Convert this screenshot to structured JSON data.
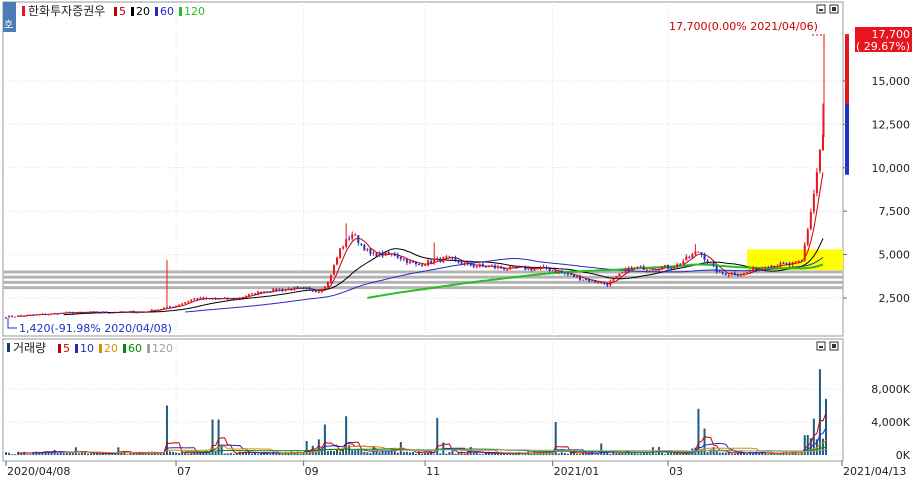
{
  "colors": {
    "up": "#e8141e",
    "down": "#1e32c8",
    "ma5": "#c80000",
    "ma20": "#000000",
    "ma60": "#2828c8",
    "ma120": "#22c022",
    "vol": "#1e5a82",
    "vol_ma5": "#c80000",
    "vol_ma10": "#2828c8",
    "vol_ma20": "#e08c00",
    "vol_ma60": "#008c00",
    "vol_ma120": "#a0a0a0",
    "highlight": "#ffff00",
    "last_price_box": "#e8141e",
    "grid": "#dcdcdc"
  },
  "header": {
    "corner_label": "호",
    "stock_name": "한화투자증권우",
    "ma_legend": [
      {
        "label": "5",
        "color": "#c80000"
      },
      {
        "label": "20",
        "color": "#000000"
      },
      {
        "label": "60",
        "color": "#2828c8"
      },
      {
        "label": "120",
        "color": "#22c022"
      }
    ]
  },
  "volume_header": {
    "title": "거래량",
    "ma_legend": [
      {
        "label": "5",
        "color": "#c80000"
      },
      {
        "label": "10",
        "color": "#2828c8"
      },
      {
        "label": "20",
        "color": "#e08c00"
      },
      {
        "label": "60",
        "color": "#008c00"
      },
      {
        "label": "120",
        "color": "#a0a0a0"
      }
    ]
  },
  "annotations": {
    "high": "17,700(0.00% 2021/04/06)",
    "low": "1,420(-91.98% 2020/04/08)",
    "last_price": "17,700",
    "last_change": "( 29.67%)"
  },
  "chart_data": [
    {
      "type": "candlestick",
      "y_axis_ticks": [
        "15,000",
        "12,500",
        "10,000",
        "7,500",
        "5,000",
        "2,500"
      ],
      "ylim": [
        1000,
        19000
      ],
      "x_ticks": [
        "2020/04/08",
        "07",
        "09",
        "11",
        "2021/01",
        "03",
        "2021/04/13"
      ],
      "anchors": [
        {
          "i": 0,
          "v": 1420
        },
        {
          "i": 20,
          "v": 1650
        },
        {
          "i": 45,
          "v": 1700
        },
        {
          "i": 55,
          "v": 2000
        },
        {
          "i": 62,
          "v": 2450
        },
        {
          "i": 75,
          "v": 2450
        },
        {
          "i": 85,
          "v": 2900
        },
        {
          "i": 95,
          "v": 3050
        },
        {
          "i": 103,
          "v": 2900
        },
        {
          "i": 106,
          "v": 3400
        },
        {
          "i": 110,
          "v": 5300
        },
        {
          "i": 114,
          "v": 6200
        },
        {
          "i": 120,
          "v": 5000
        },
        {
          "i": 128,
          "v": 5000
        },
        {
          "i": 135,
          "v": 4400
        },
        {
          "i": 145,
          "v": 4800
        },
        {
          "i": 152,
          "v": 4400
        },
        {
          "i": 165,
          "v": 4200
        },
        {
          "i": 178,
          "v": 4200
        },
        {
          "i": 190,
          "v": 3600
        },
        {
          "i": 198,
          "v": 3300
        },
        {
          "i": 205,
          "v": 4200
        },
        {
          "i": 220,
          "v": 4300
        },
        {
          "i": 228,
          "v": 5200
        },
        {
          "i": 235,
          "v": 3900
        },
        {
          "i": 243,
          "v": 3900
        },
        {
          "i": 250,
          "v": 4400
        },
        {
          "i": 258,
          "v": 4400
        },
        {
          "i": 262,
          "v": 4600
        },
        {
          "i": 264,
          "v": 6500
        },
        {
          "i": 266,
          "v": 8500
        },
        {
          "i": 268,
          "v": 11000
        },
        {
          "i": 270,
          "v": 12500
        }
      ],
      "spikes": [
        {
          "i": 53,
          "v": 4700
        },
        {
          "i": 112,
          "v": 6800
        },
        {
          "i": 141,
          "v": 5700
        },
        {
          "i": 227,
          "v": 5600
        },
        {
          "i": 269,
          "v": 13700
        }
      ],
      "highlight_zone": {
        "y_low": 4100,
        "y_high": 5300
      },
      "support_lines": [
        4000,
        3700,
        3400,
        3100
      ],
      "last_bar": {
        "open": 13700,
        "close": 17700,
        "high": 17700,
        "low": 13500
      },
      "prev_bar_span": {
        "high": 13700,
        "low": 9600
      }
    },
    {
      "type": "bar",
      "series_name": "거래량",
      "y_axis_ticks": [
        "8,000K",
        "4,000K",
        "0K"
      ],
      "ylim": [
        0,
        11000
      ],
      "spikes": [
        {
          "i": 53,
          "v": 6000
        },
        {
          "i": 68,
          "v": 4300
        },
        {
          "i": 70,
          "v": 4300
        },
        {
          "i": 105,
          "v": 3700
        },
        {
          "i": 112,
          "v": 4700
        },
        {
          "i": 142,
          "v": 4500
        },
        {
          "i": 181,
          "v": 4000
        },
        {
          "i": 228,
          "v": 5600
        },
        {
          "i": 230,
          "v": 3200
        },
        {
          "i": 266,
          "v": 4400
        },
        {
          "i": 268,
          "v": 10400
        },
        {
          "i": 270,
          "v": 6800
        }
      ]
    }
  ]
}
